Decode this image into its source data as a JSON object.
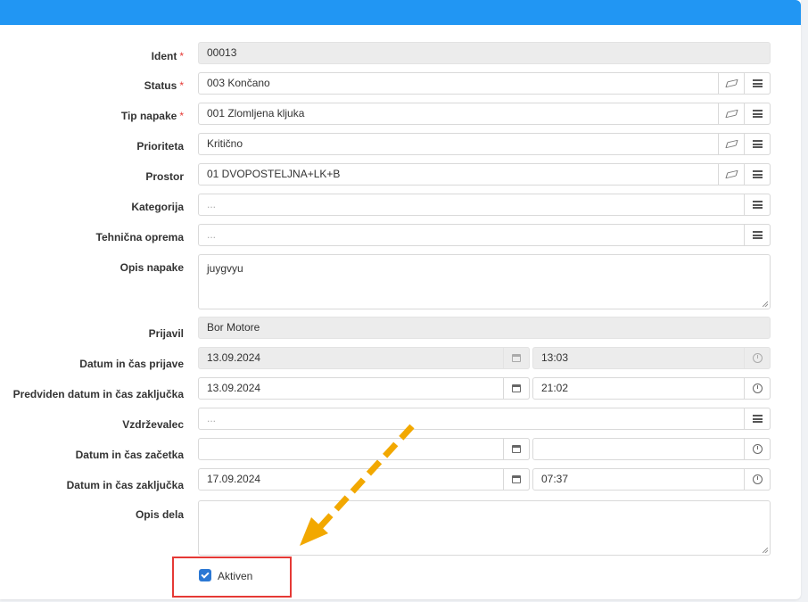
{
  "form": {
    "ident": {
      "label": "Ident",
      "required": "*",
      "value": "00013"
    },
    "status": {
      "label": "Status",
      "required": "*",
      "value": "003 Končano"
    },
    "tip_napake": {
      "label": "Tip napake",
      "required": "*",
      "value": "001 Zlomljena kljuka"
    },
    "prioriteta": {
      "label": "Prioriteta",
      "value": "Kritično"
    },
    "prostor": {
      "label": "Prostor",
      "value": "01 DVOPOSTELJNA+LK+B"
    },
    "kategorija": {
      "label": "Kategorija",
      "placeholder": "..."
    },
    "tehnicna_oprema": {
      "label": "Tehnična oprema",
      "placeholder": "..."
    },
    "opis_napake": {
      "label": "Opis napake",
      "value": "juygvyu"
    },
    "prijavil": {
      "label": "Prijavil",
      "value": "Bor Motore"
    },
    "datum_prijave": {
      "label": "Datum in čas prijave",
      "date": "13.09.2024",
      "time": "13:03"
    },
    "predviden": {
      "label": "Predviden datum in čas zaključka",
      "date": "13.09.2024",
      "time": "21:02"
    },
    "vzdrzevalec": {
      "label": "Vzdrževalec",
      "placeholder": "..."
    },
    "zacetek": {
      "label": "Datum in čas začetka",
      "date": "",
      "time": ""
    },
    "zakljucek": {
      "label": "Datum in čas zaključka",
      "date": "17.09.2024",
      "time": "07:37"
    },
    "opis_dela": {
      "label": "Opis dela",
      "value": ""
    },
    "aktiven": {
      "label": "Aktiven",
      "checked": true
    }
  },
  "colors": {
    "header": "#2196f3",
    "highlight": "#e53935",
    "arrow": "#f2a800",
    "checkbox": "#2b78d4"
  },
  "icons": {
    "clear": "eraser-icon",
    "list": "list-icon",
    "calendar": "calendar-icon",
    "time": "clock-icon"
  }
}
